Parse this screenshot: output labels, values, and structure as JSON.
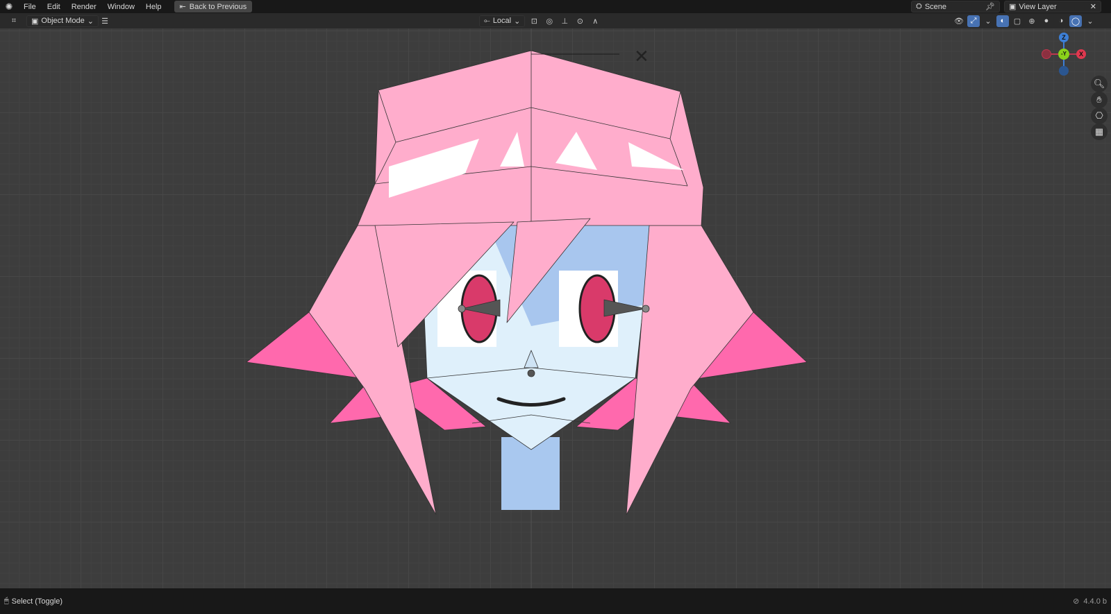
{
  "menubar": {
    "items": [
      "File",
      "Edit",
      "Render",
      "Window",
      "Help"
    ],
    "back_button": "Back to Previous"
  },
  "scene": {
    "label": "Scene"
  },
  "view_layer": {
    "label": "View Layer"
  },
  "header": {
    "mode": "Object Mode",
    "transform_orientation": "Local"
  },
  "gizmo": {
    "z": "Z",
    "y": "-Y",
    "x": "X"
  },
  "statusbar": {
    "hint": "Select (Toggle)",
    "version": "4.4.0 b"
  },
  "colors": {
    "hair": "#ffadcc",
    "hair_dark": "#ff69ad",
    "skin": "#dff0fb",
    "neck": "#a9c8ef",
    "accent": "#4772b3"
  }
}
